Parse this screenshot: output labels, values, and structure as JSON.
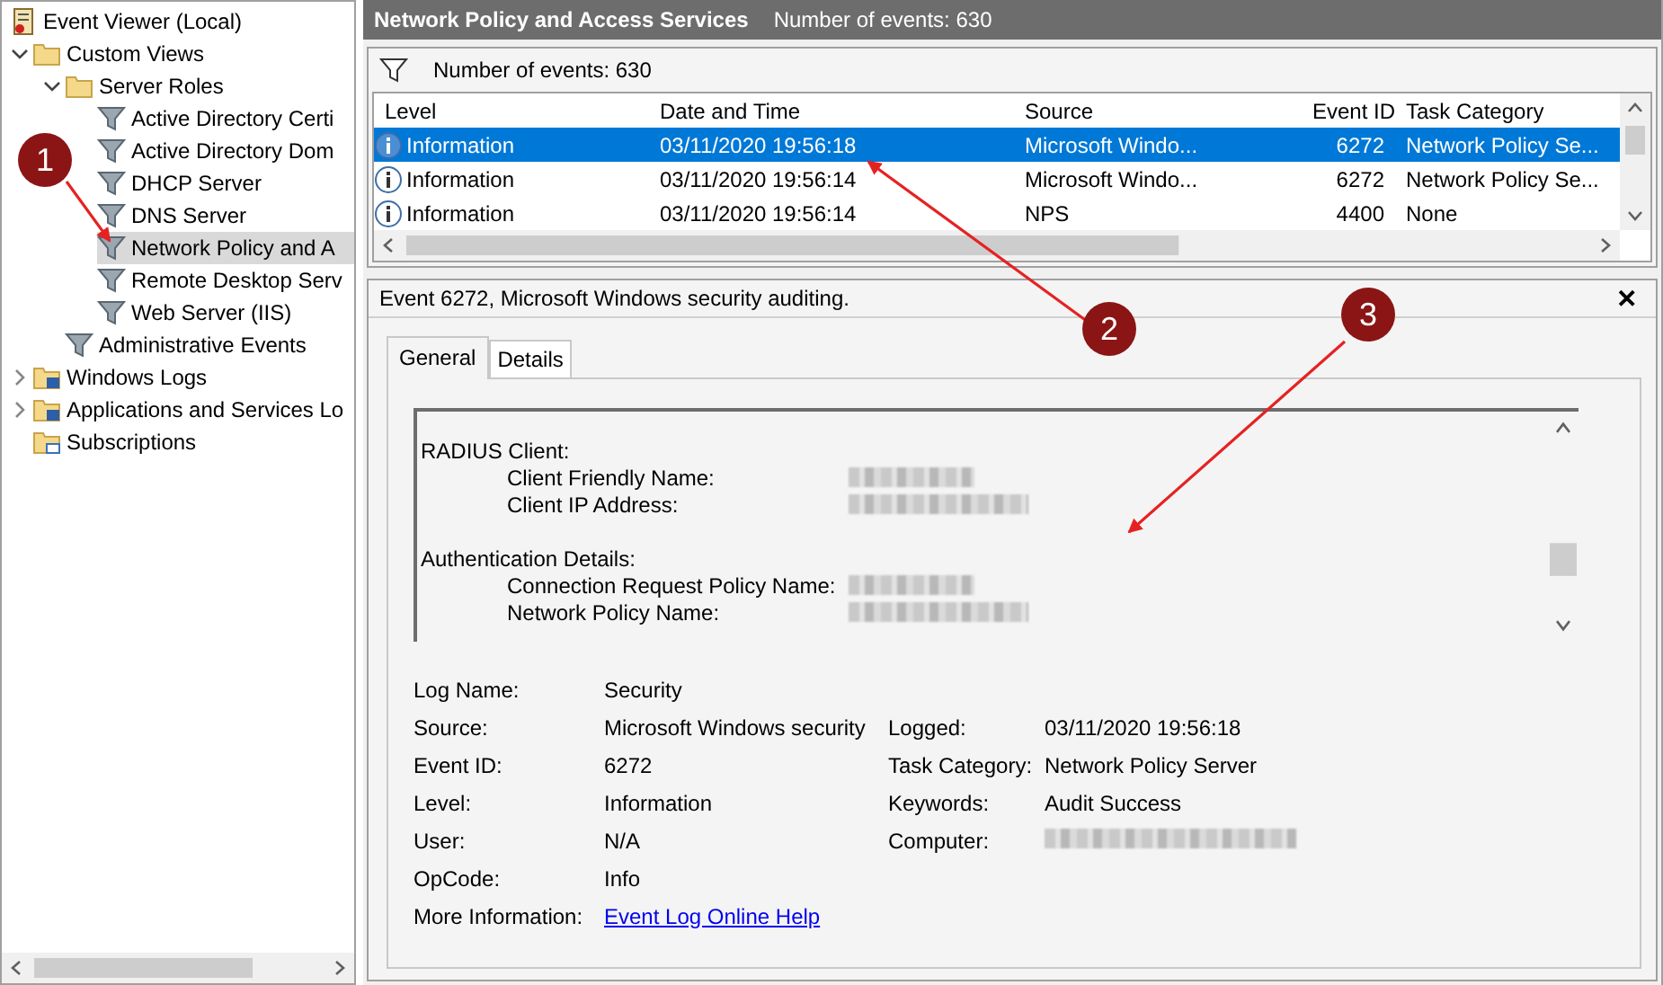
{
  "tree": [
    {
      "label": "Event Viewer (Local)",
      "kind": "root",
      "selected": false,
      "children": [
        {
          "label": "Custom Views",
          "kind": "folder",
          "expanded": true,
          "selected": false,
          "children": [
            {
              "label": "Server Roles",
              "kind": "folder",
              "expanded": true,
              "selected": false,
              "children": [
                {
                  "label": "Active Directory Certi",
                  "kind": "filter",
                  "selected": false
                },
                {
                  "label": "Active Directory Dom",
                  "kind": "filter",
                  "selected": false
                },
                {
                  "label": "DHCP Server",
                  "kind": "filter",
                  "selected": false
                },
                {
                  "label": "DNS Server",
                  "kind": "filter",
                  "selected": false
                },
                {
                  "label": "Network Policy and A",
                  "kind": "filter",
                  "selected": true
                },
                {
                  "label": "Remote Desktop Serv",
                  "kind": "filter",
                  "selected": false
                },
                {
                  "label": "Web Server (IIS)",
                  "kind": "filter",
                  "selected": false
                }
              ]
            },
            {
              "label": "Administrative Events",
              "kind": "filter",
              "selected": false
            }
          ]
        },
        {
          "label": "Windows Logs",
          "kind": "logs",
          "expanded": false,
          "selected": false
        },
        {
          "label": "Applications and Services Lo",
          "kind": "logs",
          "expanded": false,
          "selected": false
        },
        {
          "label": "Subscriptions",
          "kind": "subs",
          "selected": false
        }
      ]
    }
  ],
  "header": {
    "title": "Network Policy and Access Services",
    "count": "Number of events: 630"
  },
  "filter_bar": {
    "text": "Number of events: 630"
  },
  "table": {
    "columns": [
      "Level",
      "Date and Time",
      "Source",
      "Event ID",
      "Task Category"
    ],
    "rows": [
      {
        "cells": [
          "Information",
          "03/11/2020 19:56:18",
          "Microsoft Windo...",
          "6272",
          "Network Policy Se..."
        ],
        "selected": true
      },
      {
        "cells": [
          "Information",
          "03/11/2020 19:56:14",
          "Microsoft Windo...",
          "6272",
          "Network Policy Se..."
        ],
        "selected": false
      },
      {
        "cells": [
          "Information",
          "03/11/2020 19:56:14",
          "NPS",
          "4400",
          "None"
        ],
        "selected": false
      }
    ]
  },
  "detail": {
    "title": "Event 6272, Microsoft Windows security auditing.",
    "close": "✕",
    "tabs": [
      {
        "label": "General",
        "selected": true
      },
      {
        "label": "Details",
        "selected": false
      }
    ],
    "description": [
      {
        "kind": "heading",
        "label": "RADIUS Client:"
      },
      {
        "kind": "field",
        "label": "Client Friendly Name:",
        "redacted": true
      },
      {
        "kind": "field",
        "label": "Client IP Address:",
        "redacted": true
      },
      {
        "kind": "gap"
      },
      {
        "kind": "heading",
        "label": "Authentication Details:"
      },
      {
        "kind": "field",
        "label": "Connection Request Policy Name:",
        "redacted": true
      },
      {
        "kind": "field",
        "label": "Network Policy Name:",
        "redacted": true
      }
    ],
    "properties": [
      {
        "label": "Log Name:",
        "value": "Security"
      },
      {
        "label": "Source:",
        "value": "Microsoft Windows security",
        "label2": "Logged:",
        "value2": "03/11/2020 19:56:18"
      },
      {
        "label": "Event ID:",
        "value": "6272",
        "label2": "Task Category:",
        "value2": "Network Policy Server"
      },
      {
        "label": "Level:",
        "value": "Information",
        "label2": "Keywords:",
        "value2": "Audit Success"
      },
      {
        "label": "User:",
        "value": "N/A",
        "label2": "Computer:",
        "redacted2": true
      },
      {
        "label": "OpCode:",
        "value": "Info"
      },
      {
        "label": "More Information:",
        "link": "Event Log Online Help"
      }
    ]
  },
  "callouts": [
    {
      "label": "1"
    },
    {
      "label": "2"
    },
    {
      "label": "3"
    }
  ]
}
